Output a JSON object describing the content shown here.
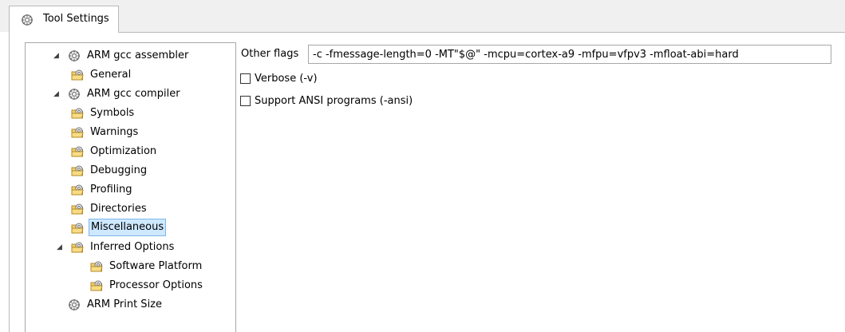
{
  "tab": {
    "label": "Tool Settings"
  },
  "tree": {
    "nodes": [
      {
        "label": "ARM gcc assembler",
        "expanded": true,
        "icon": "gear-icon"
      },
      {
        "label": "General",
        "icon": "folder-gear-icon"
      },
      {
        "label": "ARM gcc compiler",
        "expanded": true,
        "icon": "gear-icon"
      },
      {
        "label": "Symbols",
        "icon": "folder-gear-icon"
      },
      {
        "label": "Warnings",
        "icon": "folder-gear-icon"
      },
      {
        "label": "Optimization",
        "icon": "folder-gear-icon"
      },
      {
        "label": "Debugging",
        "icon": "folder-gear-icon"
      },
      {
        "label": "Profiling",
        "icon": "folder-gear-icon"
      },
      {
        "label": "Directories",
        "icon": "folder-gear-icon"
      },
      {
        "label": "Miscellaneous",
        "selected": true,
        "icon": "folder-gear-icon"
      },
      {
        "label": "Inferred Options",
        "expanded": true,
        "icon": "folder-gear-icon"
      },
      {
        "label": "Software Platform",
        "icon": "folder-gear-icon"
      },
      {
        "label": "Processor Options",
        "icon": "folder-gear-icon"
      },
      {
        "label": "ARM Print Size",
        "icon": "gear-icon"
      }
    ]
  },
  "settings": {
    "other_flags_label": "Other flags",
    "other_flags_value": "-c -fmessage-length=0 -MT\"$@\" -mcpu=cortex-a9 -mfpu=vfpv3 -mfloat-abi=hard",
    "verbose_label": "Verbose (-v)",
    "verbose_checked": false,
    "ansi_label": "Support ANSI programs (-ansi)",
    "ansi_checked": false
  }
}
